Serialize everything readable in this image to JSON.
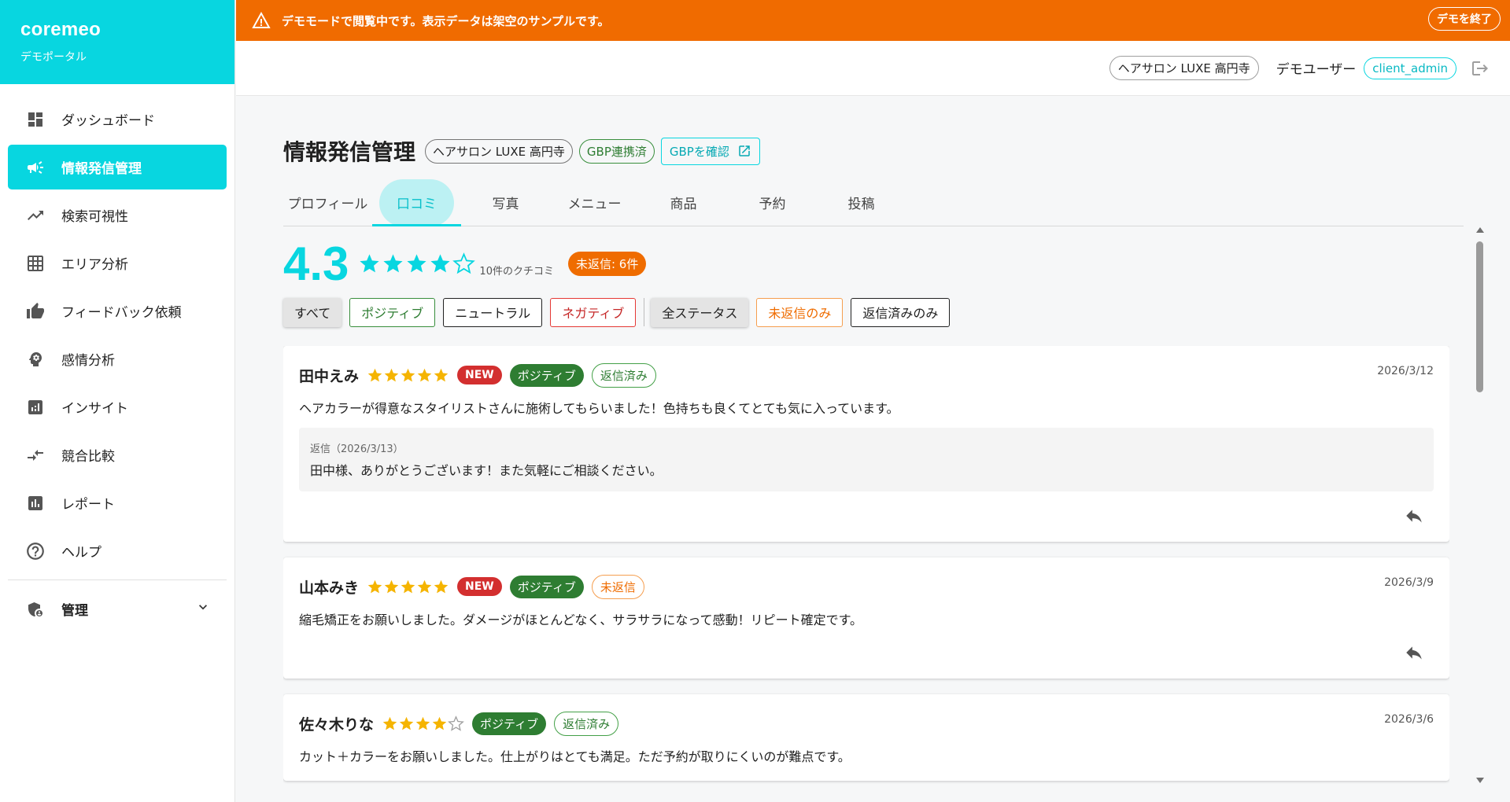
{
  "brand": {
    "name": "coremeo",
    "subtitle": "デモポータル"
  },
  "sidebar": {
    "items": [
      {
        "label": "ダッシュボード",
        "icon": "dashboard-icon"
      },
      {
        "label": "情報発信管理",
        "icon": "megaphone-icon",
        "active": true
      },
      {
        "label": "検索可視性",
        "icon": "trending-up-icon"
      },
      {
        "label": "エリア分析",
        "icon": "grid-icon"
      },
      {
        "label": "フィードバック依頼",
        "icon": "thumb-up-icon"
      },
      {
        "label": "感情分析",
        "icon": "psychology-icon"
      },
      {
        "label": "インサイト",
        "icon": "insights-icon"
      },
      {
        "label": "競合比較",
        "icon": "compare-arrows-icon"
      },
      {
        "label": "レポート",
        "icon": "bar-chart-icon"
      },
      {
        "label": "ヘルプ",
        "icon": "help-icon"
      }
    ],
    "admin": {
      "label": "管理",
      "icon": "admin-shield-icon"
    }
  },
  "banner": {
    "text": "デモモードで閲覧中です。表示データは架空のサンプルです。",
    "exit_label": "デモを終了",
    "color": "#f06b00"
  },
  "header": {
    "store": "ヘアサロン LUXE 高円寺",
    "user": "デモユーザー",
    "role": "client_admin"
  },
  "page": {
    "title": "情報発信管理",
    "store_chip": "ヘアサロン LUXE 高円寺",
    "gbp_status": "GBP連携済",
    "gbp_link": "GBPを確認"
  },
  "tabs": [
    "プロフィール",
    "口コミ",
    "写真",
    "メニュー",
    "商品",
    "予約",
    "投稿"
  ],
  "active_tab": 1,
  "summary": {
    "rating": "4.3",
    "rating_value": 4.3,
    "count_label": "10件のクチコミ",
    "unreplied_label": "未返信: 6件"
  },
  "filters": {
    "sentiment": [
      "すべて",
      "ポジティブ",
      "ニュートラル",
      "ネガティブ"
    ],
    "status": [
      "全ステータス",
      "未返信のみ",
      "返信済みのみ"
    ]
  },
  "reviews": [
    {
      "author": "田中えみ",
      "stars": 5,
      "new_label": "NEW",
      "sentiment": "ポジティブ",
      "status": "返信済み",
      "date": "2026/3/12",
      "body": "ヘアカラーが得意なスタイリストさんに施術してもらいました！色持ちも良くてとても気に入っています。",
      "reply_label": "返信（2026/3/13）",
      "reply_text": "田中様、ありがとうございます！また気軽にご相談ください。"
    },
    {
      "author": "山本みき",
      "stars": 5,
      "new_label": "NEW",
      "sentiment": "ポジティブ",
      "status": "未返信",
      "date": "2026/3/9",
      "body": "縮毛矯正をお願いしました。ダメージがほとんどなく、サラサラになって感動！リピート確定です。"
    },
    {
      "author": "佐々木りな",
      "stars": 4,
      "sentiment": "ポジティブ",
      "status": "返信済み",
      "date": "2026/3/6",
      "body": "カット＋カラーをお願いしました。仕上がりはとても満足。ただ予約が取りにくいのが難点です。"
    }
  ],
  "colors": {
    "accent": "#08d6e0",
    "star": "#f5b400",
    "positive": "#2e7d32",
    "new": "#d32f2f",
    "unreplied": "#ef6c00"
  }
}
